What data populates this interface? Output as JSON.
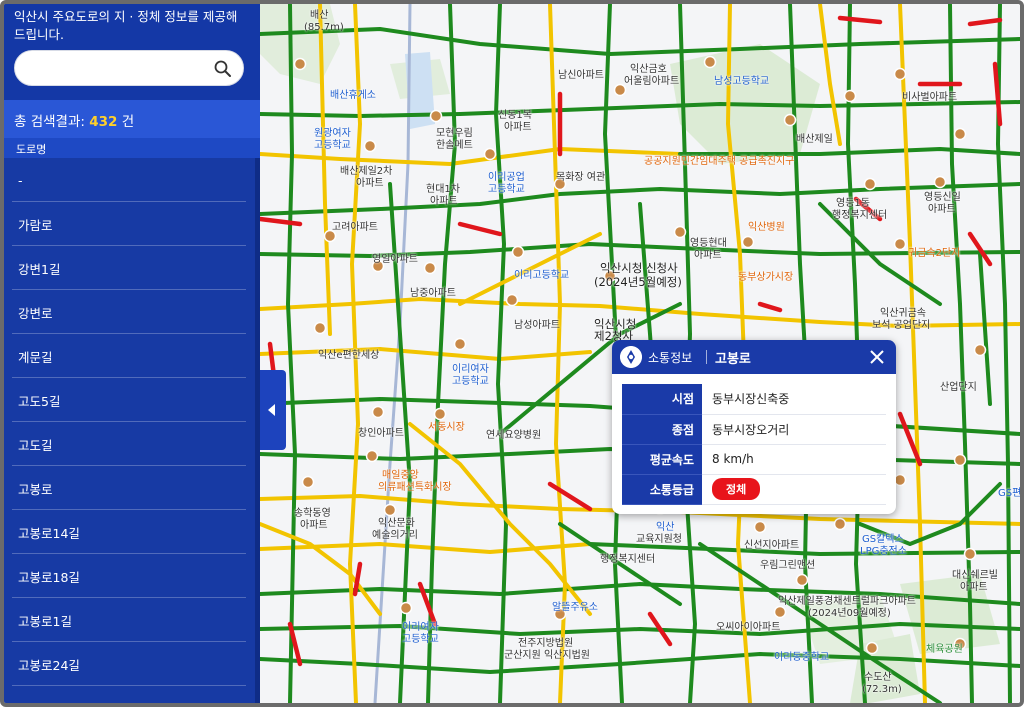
{
  "sidebar": {
    "intro_text": "익산시 주요도로의 지 · 정체 정보를 제공해 드립니다.",
    "search": {
      "placeholder": "",
      "value": ""
    },
    "result_label": "총 검색결과:",
    "result_count": "432",
    "result_unit": "건",
    "column_header": "도로명",
    "roads": [
      "-",
      "가람로",
      "강변1길",
      "강변로",
      "계문길",
      "고도5길",
      "고도길",
      "고봉로",
      "고봉로14길",
      "고봉로18길",
      "고봉로1길",
      "고봉로24길"
    ]
  },
  "colors": {
    "sidebar": "#173aa4",
    "accent": "#ffd02b",
    "traffic_smooth": "#1e8a1e",
    "traffic_slow": "#f2c400",
    "traffic_jam": "#e0161c"
  },
  "map": {
    "labels": [
      {
        "text": "배산",
        "cls": "",
        "id": "lbl-baesan"
      },
      {
        "text": "(85.7m)",
        "cls": "",
        "id": "lbl-baesan-h"
      },
      {
        "text": "배산휴게소",
        "cls": "",
        "id": "lbl-rest"
      },
      {
        "text": "원광여자",
        "cls": "blue",
        "id": "lbl-wg1"
      },
      {
        "text": "고등학교",
        "cls": "blue",
        "id": "lbl-wg2"
      },
      {
        "text": "모현우림",
        "cls": "",
        "id": "lbl-mh1"
      },
      {
        "text": "한솔메트",
        "cls": "",
        "id": "lbl-mh2"
      },
      {
        "text": "배산제일2차",
        "cls": "",
        "id": "lbl-bs2"
      },
      {
        "text": "아파트",
        "cls": "",
        "id": "lbl-bs2b"
      },
      {
        "text": "현대1차",
        "cls": "",
        "id": "lbl-hd1"
      },
      {
        "text": "아파트",
        "cls": "",
        "id": "lbl-hd1b"
      },
      {
        "text": "이리공업",
        "cls": "blue",
        "id": "lbl-irg1"
      },
      {
        "text": "고등학교",
        "cls": "blue",
        "id": "lbl-irg2"
      },
      {
        "text": "신동1복",
        "cls": "",
        "id": "lbl-sd1"
      },
      {
        "text": "아파트",
        "cls": "",
        "id": "lbl-sd1b"
      },
      {
        "text": "목화장 여관",
        "cls": "",
        "id": "lbl-mh"
      },
      {
        "text": "고려아파트",
        "cls": "",
        "id": "lbl-gr"
      },
      {
        "text": "영일아파트",
        "cls": "",
        "id": "lbl-yi"
      },
      {
        "text": "남중아파트",
        "cls": "",
        "id": "lbl-nj"
      },
      {
        "text": "이리고등학교",
        "cls": "blue",
        "id": "lbl-irihs"
      },
      {
        "text": "익산시청 신청사",
        "cls": "big",
        "id": "lbl-cityhall"
      },
      {
        "text": "(2024년5월예정)",
        "cls": "big",
        "id": "lbl-cityhall2"
      },
      {
        "text": "익산시청",
        "cls": "big",
        "id": "lbl-ch2"
      },
      {
        "text": "제2청사",
        "cls": "big",
        "id": "lbl-ch3"
      },
      {
        "text": "남성아파트",
        "cls": "",
        "id": "lbl-ns"
      },
      {
        "text": "영등현대",
        "cls": "",
        "id": "lbl-ydhd"
      },
      {
        "text": "아파트",
        "cls": "",
        "id": "lbl-ydhd2"
      },
      {
        "text": "동부상가시장",
        "cls": "orange",
        "id": "lbl-dbsj"
      },
      {
        "text": "익산e편한세상",
        "cls": "",
        "id": "lbl-ep"
      },
      {
        "text": "이리여자",
        "cls": "blue",
        "id": "lbl-irw1"
      },
      {
        "text": "고등학교",
        "cls": "blue",
        "id": "lbl-irw2"
      },
      {
        "text": "서동시장",
        "cls": "orange",
        "id": "lbl-sdsj"
      },
      {
        "text": "연세요양병원",
        "cls": "",
        "id": "lbl-ys"
      },
      {
        "text": "창인아파트",
        "cls": "",
        "id": "lbl-ci"
      },
      {
        "text": "매일중앙",
        "cls": "orange",
        "id": "lbl-mijo"
      },
      {
        "text": "의류패션특화시장",
        "cls": "orange",
        "id": "lbl-ui"
      },
      {
        "text": "송학동영",
        "cls": "",
        "id": "lbl-sh"
      },
      {
        "text": "아파트",
        "cls": "",
        "id": "lbl-sh2"
      },
      {
        "text": "익산문화",
        "cls": "",
        "id": "lbl-ms"
      },
      {
        "text": "예술의거리",
        "cls": "",
        "id": "lbl-ms2"
      },
      {
        "text": "익산",
        "cls": "blue",
        "id": "lbl-is1"
      },
      {
        "text": "교육지원청",
        "cls": "",
        "id": "lbl-is2"
      },
      {
        "text": "행정복지센터",
        "cls": "",
        "id": "lbl-hj"
      },
      {
        "text": "신선지아파트",
        "cls": "",
        "id": "lbl-ss"
      },
      {
        "text": "우림그린맨션",
        "cls": "",
        "id": "lbl-ur"
      },
      {
        "text": "GS칼텍스",
        "cls": "blue",
        "id": "lbl-gs1"
      },
      {
        "text": "LPG충전소",
        "cls": "blue",
        "id": "lbl-gs2"
      },
      {
        "text": "대신쉐르빌",
        "cls": "",
        "id": "lbl-ds"
      },
      {
        "text": "아파트",
        "cls": "",
        "id": "lbl-ds2"
      },
      {
        "text": "익산제일풍경채센트럴파크아파트",
        "cls": "",
        "id": "lbl-pg"
      },
      {
        "text": "(2024년09월예정)",
        "cls": "",
        "id": "lbl-pg2"
      },
      {
        "text": "오씨아이아파트",
        "cls": "",
        "id": "lbl-oci"
      },
      {
        "text": "이리동중학교",
        "cls": "blue",
        "id": "lbl-idj"
      },
      {
        "text": "이리여자",
        "cls": "blue",
        "id": "lbl-irw3"
      },
      {
        "text": "고등학교",
        "cls": "blue",
        "id": "lbl-irw4"
      },
      {
        "text": "알뜰주유소",
        "cls": "blue",
        "id": "lbl-ad"
      },
      {
        "text": "전주지방법원",
        "cls": "",
        "id": "lbl-court"
      },
      {
        "text": "군산지원 익산지법원",
        "cls": "",
        "id": "lbl-court2"
      },
      {
        "text": "체육공원",
        "cls": "green",
        "id": "lbl-park"
      },
      {
        "text": "수도산",
        "cls": "",
        "id": "lbl-sds"
      },
      {
        "text": "(72.3m)",
        "cls": "",
        "id": "lbl-sds2"
      },
      {
        "text": "산업단지",
        "cls": "",
        "id": "lbl-sandan"
      },
      {
        "text": "익산귀금속",
        "cls": "",
        "id": "lbl-gg"
      },
      {
        "text": "보석 공업단지",
        "cls": "",
        "id": "lbl-gg2"
      },
      {
        "text": "귀금속2단지",
        "cls": "orange",
        "id": "lbl-gg3"
      },
      {
        "text": "영등1동",
        "cls": "",
        "id": "lbl-yd1"
      },
      {
        "text": "행정복지센터",
        "cls": "",
        "id": "lbl-yd2"
      },
      {
        "text": "영등신일",
        "cls": "",
        "id": "lbl-ydsi"
      },
      {
        "text": "아파트",
        "cls": "",
        "id": "lbl-ydsi2"
      },
      {
        "text": "비사벌아파트",
        "cls": "",
        "id": "lbl-bsb"
      },
      {
        "text": "남성고등학교",
        "cls": "blue",
        "id": "lbl-nsh"
      },
      {
        "text": "익산금호",
        "cls": "",
        "id": "lbl-ikgh"
      },
      {
        "text": "어울림아파트",
        "cls": "",
        "id": "lbl-ikgh2"
      },
      {
        "text": "남신아파트",
        "cls": "",
        "id": "lbl-nsn"
      },
      {
        "text": "공공지원민간임대주택 공급촉진지구",
        "cls": "orange",
        "id": "lbl-gg4"
      },
      {
        "text": "익산병원",
        "cls": "orange",
        "id": "lbl-ikh"
      },
      {
        "text": "GS편",
        "cls": "blue",
        "id": "lbl-gsp"
      },
      {
        "text": "배산제일",
        "cls": "",
        "id": "lbl-bsj"
      }
    ]
  },
  "popup": {
    "category": "소통정보",
    "road_name": "고봉로",
    "rows": [
      {
        "key": "시점",
        "value": "동부시장신축중"
      },
      {
        "key": "종점",
        "value": "동부시장오거리"
      },
      {
        "key": "평균속도",
        "value": "8 km/h"
      },
      {
        "key": "소통등급",
        "value": "정체"
      }
    ]
  }
}
